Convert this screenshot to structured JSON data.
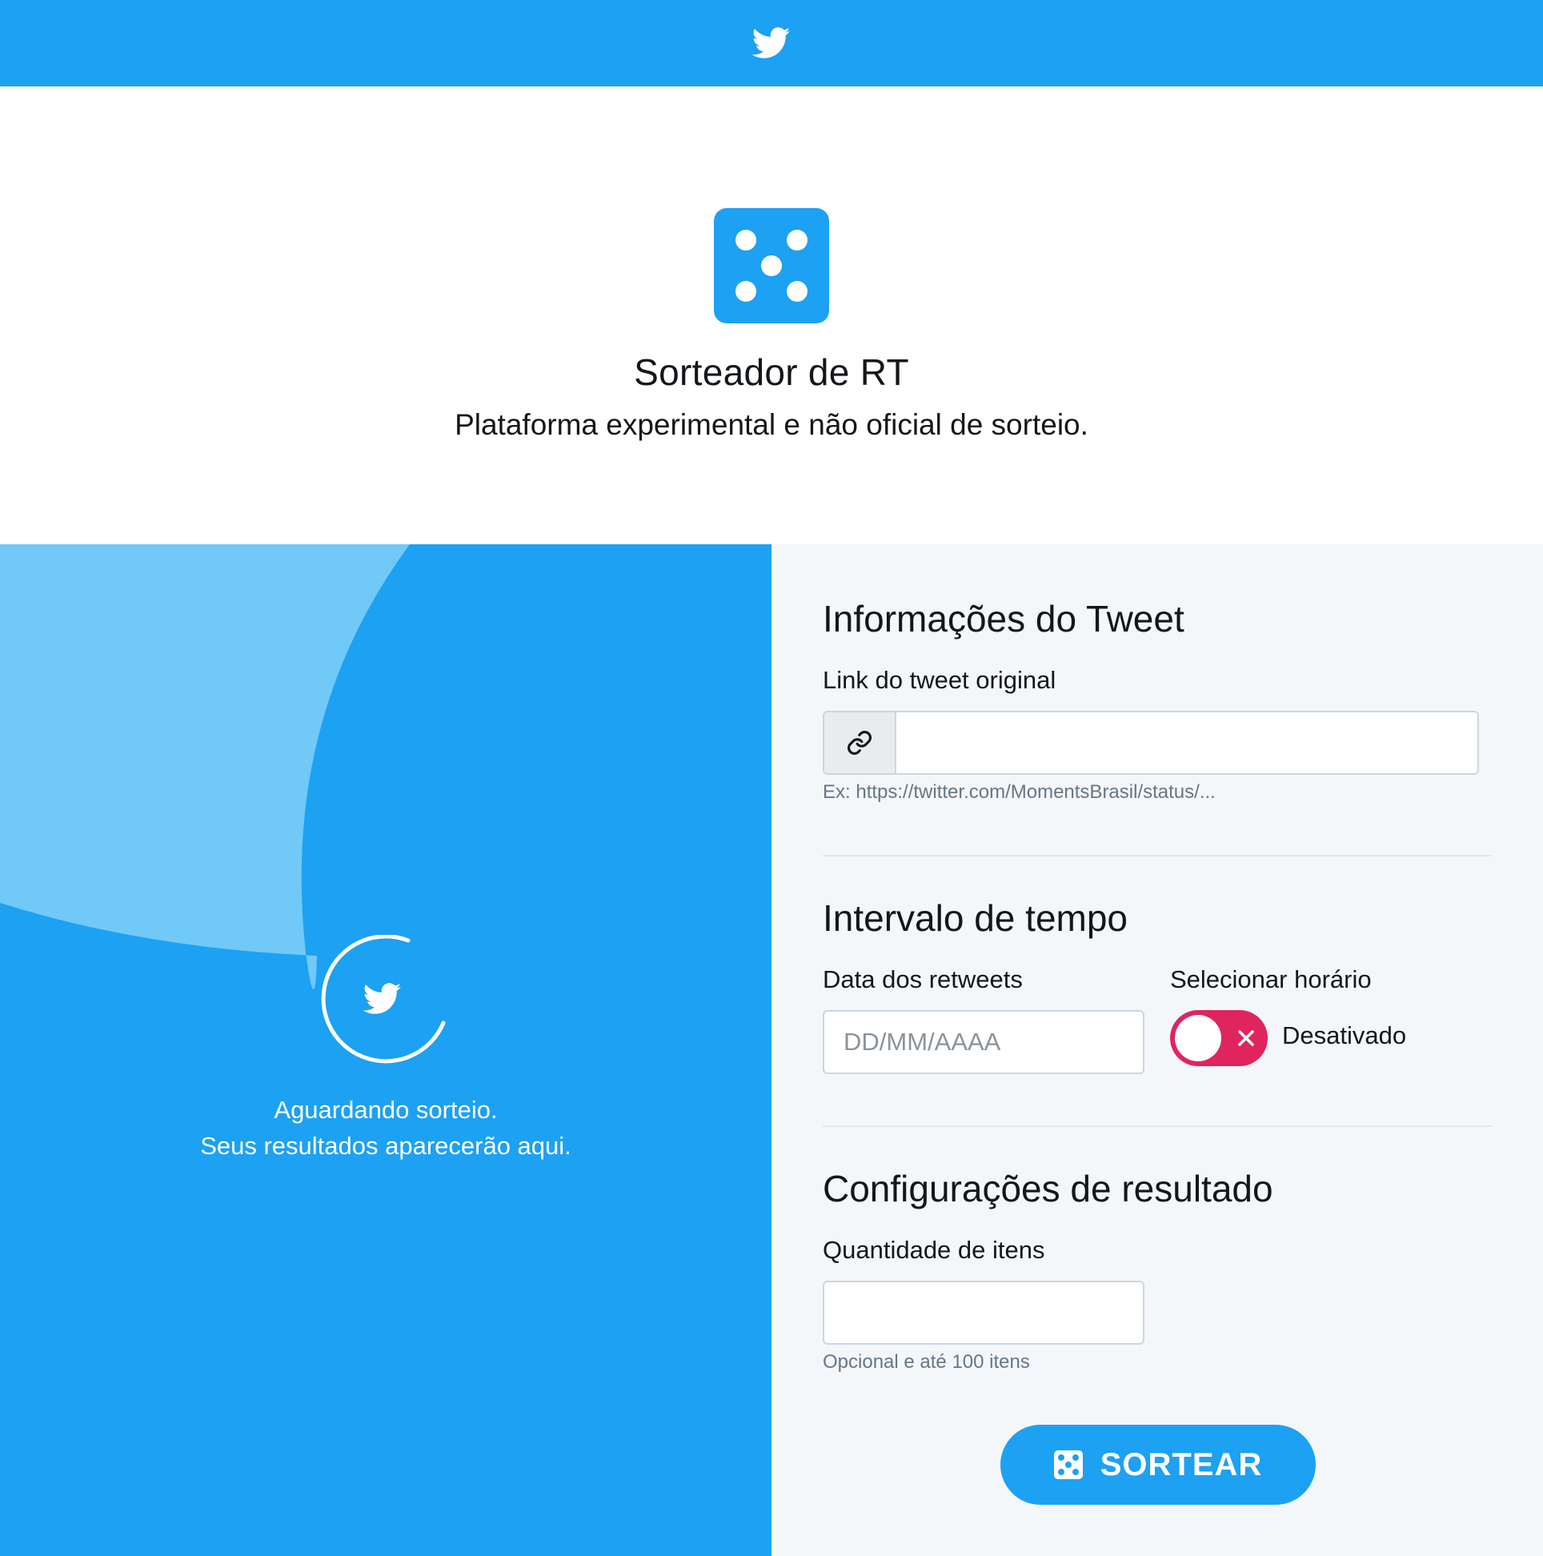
{
  "header": {
    "logo_icon": "twitter-bird-icon",
    "brand_color": "#1da1f2"
  },
  "hero": {
    "logo_icon": "dice-five-icon",
    "title": "Sorteador de RT",
    "subtitle": "Plataforma experimental e não oficial de sorteio."
  },
  "status_panel": {
    "icon": "twitter-bird-spinner-icon",
    "line1": "Aguardando sorteio.",
    "line2": "Seus resultados aparecerão aqui.",
    "background_color": "#1da1f2",
    "accent_color": "#71c9f8"
  },
  "form": {
    "tweet_section": {
      "title": "Informações do Tweet",
      "link_label": "Link do tweet original",
      "link_icon": "link-icon",
      "link_value": "",
      "link_help": "Ex: https://twitter.com/MomentsBrasil/status/..."
    },
    "time_section": {
      "title": "Intervalo de tempo",
      "date_label": "Data dos retweets",
      "date_placeholder": "DD/MM/AAAA",
      "date_value": "",
      "time_toggle_label": "Selecionar horário",
      "time_toggle_state": "Desativado",
      "time_toggle_on": false,
      "toggle_off_color": "#e0245e"
    },
    "result_section": {
      "title": "Configurações de resultado",
      "quantity_label": "Quantidade de itens",
      "quantity_value": "",
      "quantity_help": "Opcional e até 100 itens"
    },
    "submit": {
      "label": "SORTEAR",
      "icon": "dice-icon"
    }
  }
}
